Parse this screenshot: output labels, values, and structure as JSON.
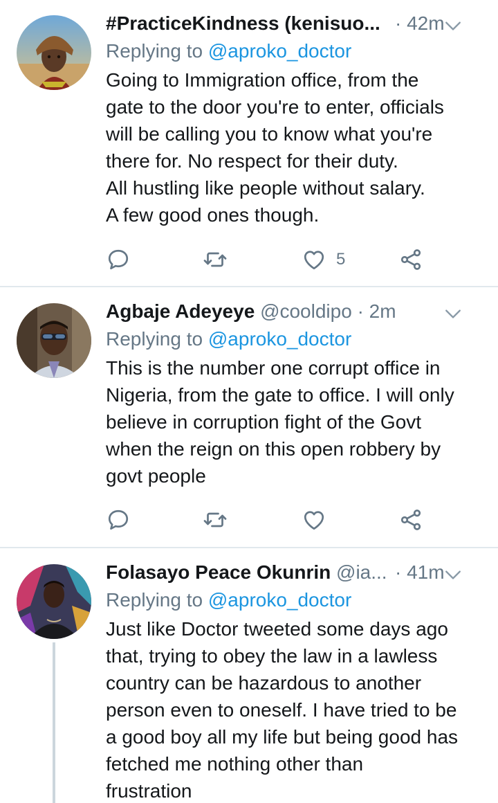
{
  "tweets": [
    {
      "name": "#PracticeKindness (kenisuo...",
      "handle": "",
      "time": "· 42m",
      "replying_prefix": "Replying to ",
      "replying_to": "@aproko_doctor",
      "text": "Going to Immigration office, from the\ngate to the door you're to enter, officials\nwill be calling you to know what you're\nthere for. No respect for their duty.\nAll hustling like people without salary.\nA few good ones though.",
      "like_count": "5",
      "retweet_count": "",
      "reply_count": "",
      "icons": {
        "reply": "reply-icon",
        "retweet": "retweet-icon",
        "like": "heart-icon",
        "share": "share-icon",
        "menu": "chevron-down-icon"
      }
    },
    {
      "name": "Agbaje Adeyeye",
      "handle": "@cooldipo",
      "time": "· 2m",
      "replying_prefix": "Replying to ",
      "replying_to": "@aproko_doctor",
      "text": "This is the number one corrupt office in\nNigeria, from the gate to office. I will only\nbelieve in corruption fight of the Govt\nwhen the reign on this open robbery by\ngovt people",
      "like_count": "",
      "retweet_count": "",
      "reply_count": ""
    },
    {
      "name": "Folasayo Peace Okunrin",
      "handle": "@ia...",
      "time": "· 41m",
      "replying_prefix": "Replying to ",
      "replying_to": "@aproko_doctor",
      "text": "Just like Doctor tweeted some days ago\nthat, trying to obey the law in a lawless\ncountry can be hazardous to another\nperson even to oneself. I have tried to be\na good boy all my life but being good has\nfetched me nothing other than\nfrustration"
    }
  ],
  "colors": {
    "text": "#14171a",
    "secondary": "#657786",
    "link": "#1b95e0",
    "divider": "#e1e8ed",
    "thread_line": "#ccd6dd"
  }
}
